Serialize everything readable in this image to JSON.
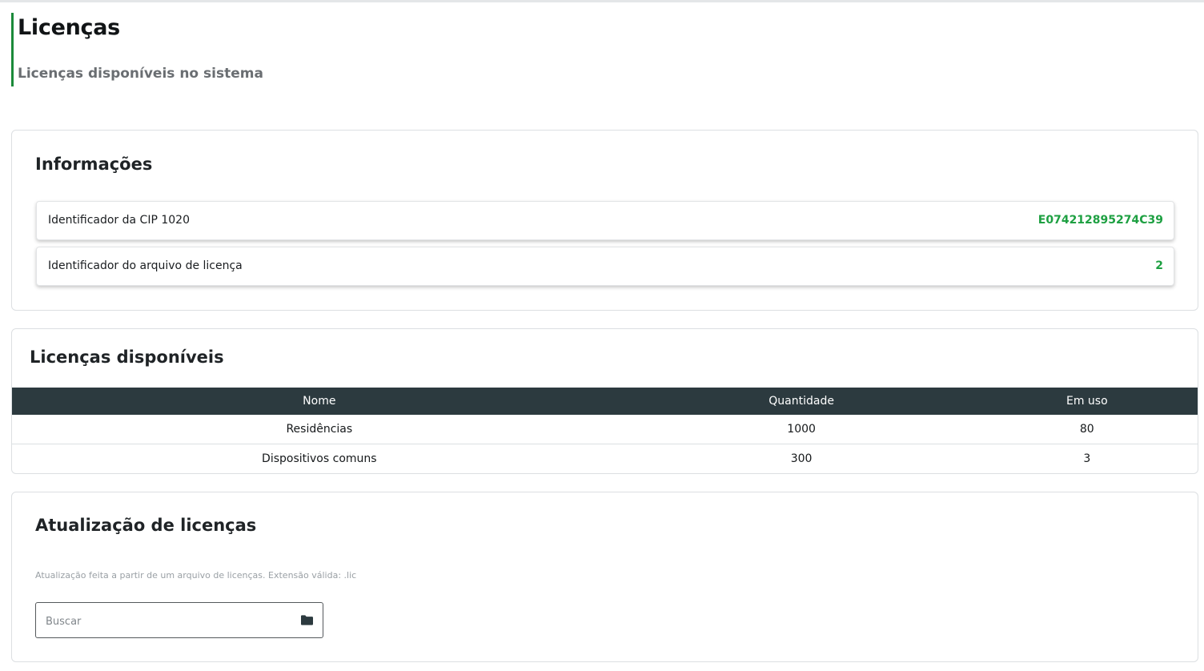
{
  "page": {
    "title": "Licenças",
    "subtitle": "Licenças disponíveis no sistema"
  },
  "info": {
    "title": "Informações",
    "rows": [
      {
        "label": "Identificador da CIP 1020",
        "value": "E074212895274C39"
      },
      {
        "label": "Identificador do arquivo de licença",
        "value": "2"
      }
    ]
  },
  "licenses": {
    "title": "Licenças disponíveis",
    "columns": [
      "Nome",
      "Quantidade",
      "Em uso"
    ],
    "rows": [
      [
        "Residências",
        "1000",
        "80"
      ],
      [
        "Dispositivos comuns",
        "300",
        "3"
      ]
    ]
  },
  "update": {
    "title": "Atualização de licenças",
    "hint": "Atualização feita a partir de um arquivo de licenças. Extensão válida: .lic",
    "input_placeholder": "Buscar",
    "icon": "folder-icon"
  },
  "colors": {
    "accent": "#1b8a3a",
    "value_green": "#1ea042",
    "table_header": "#2c3a3f"
  }
}
